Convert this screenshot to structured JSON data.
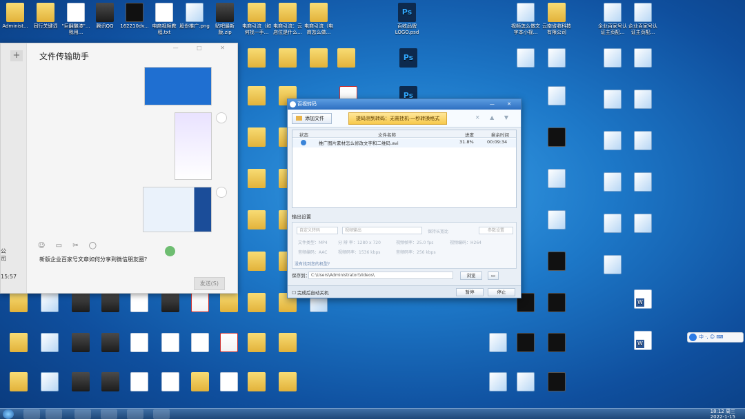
{
  "desktop_icons": [
    {
      "label": "Administ...",
      "type": "folder"
    },
    {
      "label": "同行关键词",
      "type": "folder"
    },
    {
      "label": "\"巨翻雕漆\"...我用...",
      "type": "doc"
    },
    {
      "label": "腾讯QQ",
      "type": "app"
    },
    {
      "label": "162210dv...",
      "type": "video"
    },
    {
      "label": "电商视频教程.txt",
      "type": "doc"
    },
    {
      "label": "股份推广.png",
      "type": "img"
    },
    {
      "label": "贴吧最新版.zip",
      "type": "app"
    },
    {
      "label": "电商引流（如何找一手...",
      "type": "folder"
    },
    {
      "label": "电商引流：云店位是什么...",
      "type": "folder"
    },
    {
      "label": "电商引流（电商怎么做...",
      "type": "folder"
    },
    {
      "label": "百收品牌LOGO.psd",
      "type": "ps"
    },
    {
      "label": "视频怎么做文字本小视...",
      "type": "img"
    },
    {
      "label": "云南省收科技有限公司",
      "type": "folder"
    },
    {
      "label": "企业百家号认证主页配...",
      "type": "img"
    },
    {
      "label": "企业百家号认证主页配...",
      "type": "img"
    }
  ],
  "wechat": {
    "title": "文件传输助手",
    "message_input": "新版企业百家号文章如何分享到微信朋友圈？",
    "send_label": "发送(S)",
    "sidebar_edge_texts": [
      "公司",
      "15:57"
    ]
  },
  "converter": {
    "title": "百视转码",
    "add_file_label": "添加文件",
    "promo_label": "提码测到转码：无需挂机·一秒转换格式",
    "columns": [
      "状态",
      "文件名称",
      "进度",
      "剩余时间"
    ],
    "task": {
      "file_name": "推广图片素材怎么修改文字和二维码.avi",
      "progress": "31.8%",
      "progress_value": 0.318,
      "remaining": "00:09:34"
    },
    "output_section_title": "输出设置",
    "format_select": "自定义转码",
    "preset_select": "视频输出",
    "keep_ratio_label": "保持长宽比",
    "params_button": "参数设置",
    "params": [
      "文件类型：MP4",
      "分 辨 率：1280 x 720",
      "视频帧率：25.0 fps",
      "视频编码：H264",
      "音频编码：AAC",
      "视频码率：1536 kbps",
      "音频码率：256 kbps"
    ],
    "hint": "没有找到您的机型?",
    "save_to_label": "保存到：",
    "save_path": "C:\\Users\\Administrator\\Videos\\",
    "browse_label": "浏览",
    "shutdown_label": "完成后自动关机",
    "pause_label": "暂停",
    "stop_label": "停止"
  },
  "ime": {
    "label": "中 ·, ☺ ⌨"
  },
  "taskbar": {
    "time": "18:12 周三",
    "date": "2022-1-15"
  }
}
